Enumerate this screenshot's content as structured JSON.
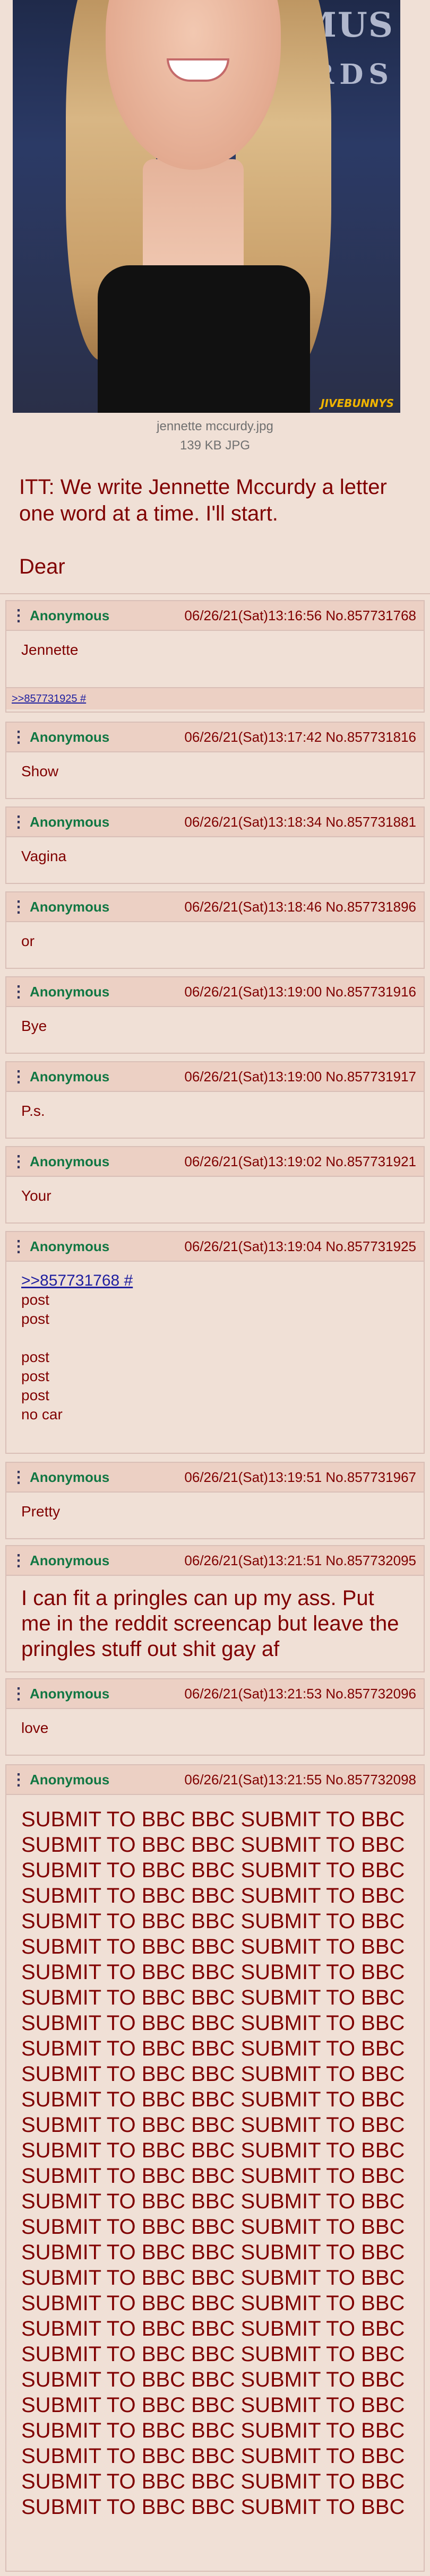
{
  "op": {
    "image_text_top": "Y MUS",
    "image_text_bottom": "RDS",
    "image_watermark": "JIVEBUNNYS",
    "file_name": "jennette mccurdy.jpg",
    "file_size": "139 KB JPG",
    "line1": "ITT: We write Jennette Mccurdy a letter",
    "line2": "one word at a time. I'll start.",
    "line3": "Dear"
  },
  "menu_icon": "⋮",
  "posts": [
    {
      "name": "Anonymous",
      "meta": "06/26/21(Sat)13:16:56 No.857731768",
      "body": [
        "Jennette"
      ],
      "backlink": ">>857731925 #"
    },
    {
      "name": "Anonymous",
      "meta": "06/26/21(Sat)13:17:42 No.857731816",
      "body": [
        "Show"
      ]
    },
    {
      "name": "Anonymous",
      "meta": "06/26/21(Sat)13:18:34 No.857731881",
      "body": [
        "Vagina"
      ]
    },
    {
      "name": "Anonymous",
      "meta": "06/26/21(Sat)13:18:46 No.857731896",
      "body": [
        "or"
      ]
    },
    {
      "name": "Anonymous",
      "meta": "06/26/21(Sat)13:19:00 No.857731916",
      "body": [
        "Bye"
      ]
    },
    {
      "name": "Anonymous",
      "meta": "06/26/21(Sat)13:19:00 No.857731917",
      "body": [
        "P.s."
      ]
    },
    {
      "name": "Anonymous",
      "meta": "06/26/21(Sat)13:19:02 No.857731921",
      "body": [
        "Your"
      ]
    },
    {
      "name": "Anonymous",
      "meta": "06/26/21(Sat)13:19:04 No.857731925",
      "quote": ">>857731768 #",
      "body": [
        "post",
        "post",
        "",
        "post",
        "post",
        "post",
        "no car"
      ]
    },
    {
      "name": "Anonymous",
      "meta": "06/26/21(Sat)13:19:51 No.857731967",
      "body": [
        "Pretty"
      ]
    },
    {
      "name": "Anonymous",
      "meta": "06/26/21(Sat)13:21:51 No.857732095",
      "body": [
        "I can fit a pringles can up my ass. Put",
        "me in the reddit screencap but leave the",
        "pringles stuff out shit gay af"
      ]
    },
    {
      "name": "Anonymous",
      "meta": "06/26/21(Sat)13:21:53 No.857732096",
      "body": [
        "love"
      ]
    },
    {
      "name": "Anonymous",
      "meta": "06/26/21(Sat)13:21:55 No.857732098",
      "body_line": "SUBMIT TO BBC BBC SUBMIT TO BBC",
      "body_repeat_count": 28
    }
  ]
}
